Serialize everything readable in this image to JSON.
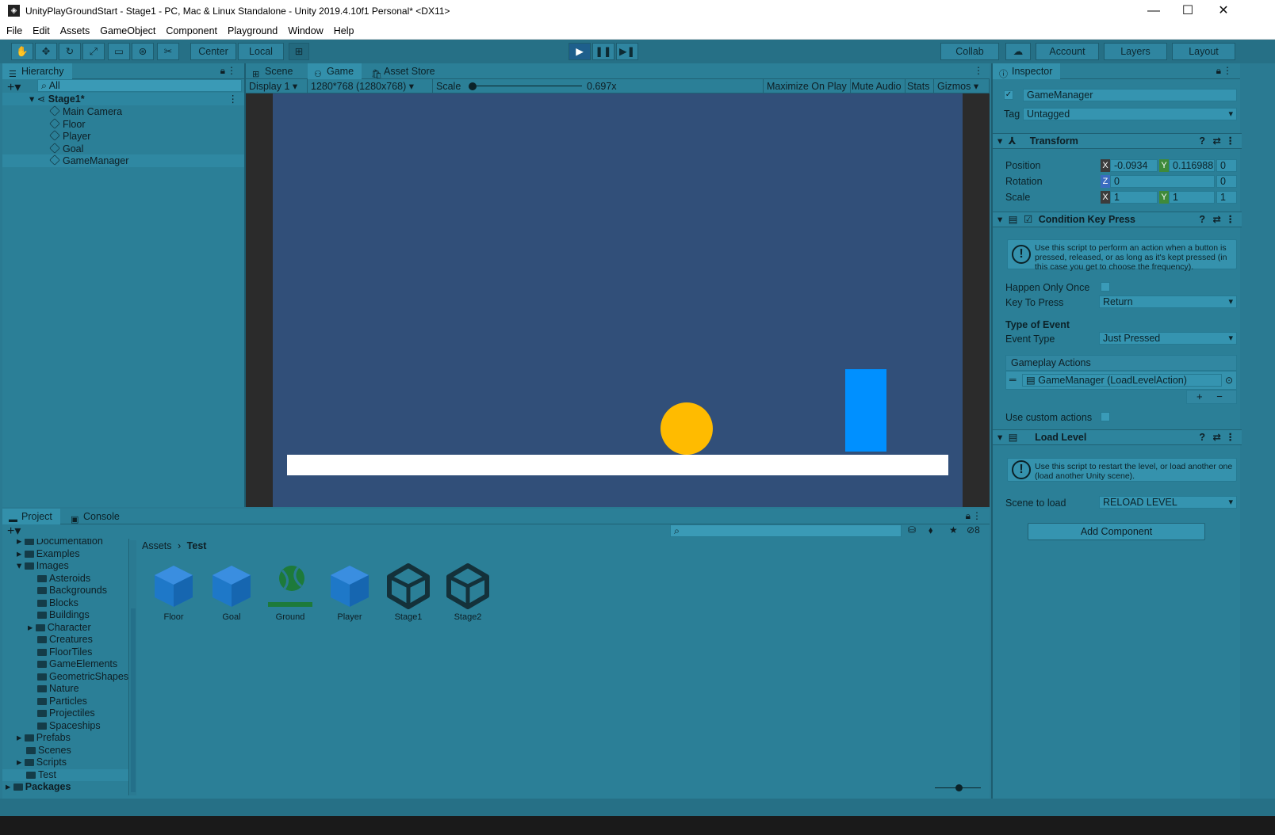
{
  "window": {
    "title": "UnityPlayGroundStart - Stage1 - PC, Mac & Linux Standalone - Unity 2019.4.10f1 Personal* <DX11>",
    "minimize": "—",
    "maximize": "☐",
    "close": "✕"
  },
  "menu": [
    "File",
    "Edit",
    "Assets",
    "GameObject",
    "Component",
    "Playground",
    "Window",
    "Help"
  ],
  "toolbar": {
    "pivot": "Center",
    "space": "Local",
    "collab": "Collab",
    "account": "Account",
    "layers": "Layers",
    "layout": "Layout"
  },
  "hierarchy": {
    "tab": "Hierarchy",
    "search_placeholder": "All",
    "scene": "Stage1*",
    "items": [
      "Main Camera",
      "Floor",
      "Player",
      "Goal",
      "GameManager"
    ]
  },
  "game": {
    "tabs": [
      "Scene",
      "Game",
      "Asset Store"
    ],
    "display": "Display 1",
    "resolution": "1280*768 (1280x768)",
    "scale_label": "Scale",
    "scale_value": "0.697x",
    "maximize": "Maximize On Play",
    "mute": "Mute Audio",
    "stats": "Stats",
    "gizmos": "Gizmos",
    "colors": {
      "background": "#314f79",
      "player": "#ffbb00",
      "goal": "#0090ff",
      "floor": "#ffffff"
    }
  },
  "inspector": {
    "tab": "Inspector",
    "object_name": "GameManager",
    "tag_label": "Tag",
    "tag_value": "Untagged",
    "transform": {
      "title": "Transform",
      "position_label": "Position",
      "rotation_label": "Rotation",
      "scale_label": "Scale",
      "pos_x": "-0.0934",
      "pos_y": "0.116988",
      "pos_z": "0",
      "rot_z": "0",
      "rot_w": "0",
      "scale_x": "1",
      "scale_y": "1",
      "scale_z": "1"
    },
    "condition": {
      "title": "Condition Key Press",
      "help": "Use this script to perform an action when a button is pressed, released, or as long as it's kept pressed (in this case you get to choose the frequency).",
      "happen_once_label": "Happen Only Once",
      "key_label": "Key To Press",
      "key_value": "Return",
      "type_header": "Type of Event",
      "event_label": "Event Type",
      "event_value": "Just Pressed",
      "actions_header": "Gameplay Actions",
      "action_item": "GameManager (LoadLevelAction)",
      "custom_label": "Use custom actions"
    },
    "load_level": {
      "title": "Load Level",
      "help": "Use this script to restart the level, or load another one (load another Unity scene).",
      "scene_label": "Scene to load",
      "scene_value": "RELOAD LEVEL"
    },
    "add_component": "Add Component"
  },
  "project": {
    "tabs": [
      "Project",
      "Console"
    ],
    "breadcrumb_root": "Assets",
    "breadcrumb_current": "Test",
    "hidden_count": "8",
    "tree": [
      "Documentation",
      "Examples",
      "Images",
      "Asteroids",
      "Backgrounds",
      "Blocks",
      "Buildings",
      "Character",
      "Creatures",
      "FloorTiles",
      "GameElements",
      "GeometricShapes",
      "Nature",
      "Particles",
      "Projectiles",
      "Spaceships",
      "Prefabs",
      "Scenes",
      "Scripts",
      "Test",
      "Packages"
    ],
    "assets": [
      "Floor",
      "Goal",
      "Ground",
      "Player",
      "Stage1",
      "Stage2"
    ]
  }
}
